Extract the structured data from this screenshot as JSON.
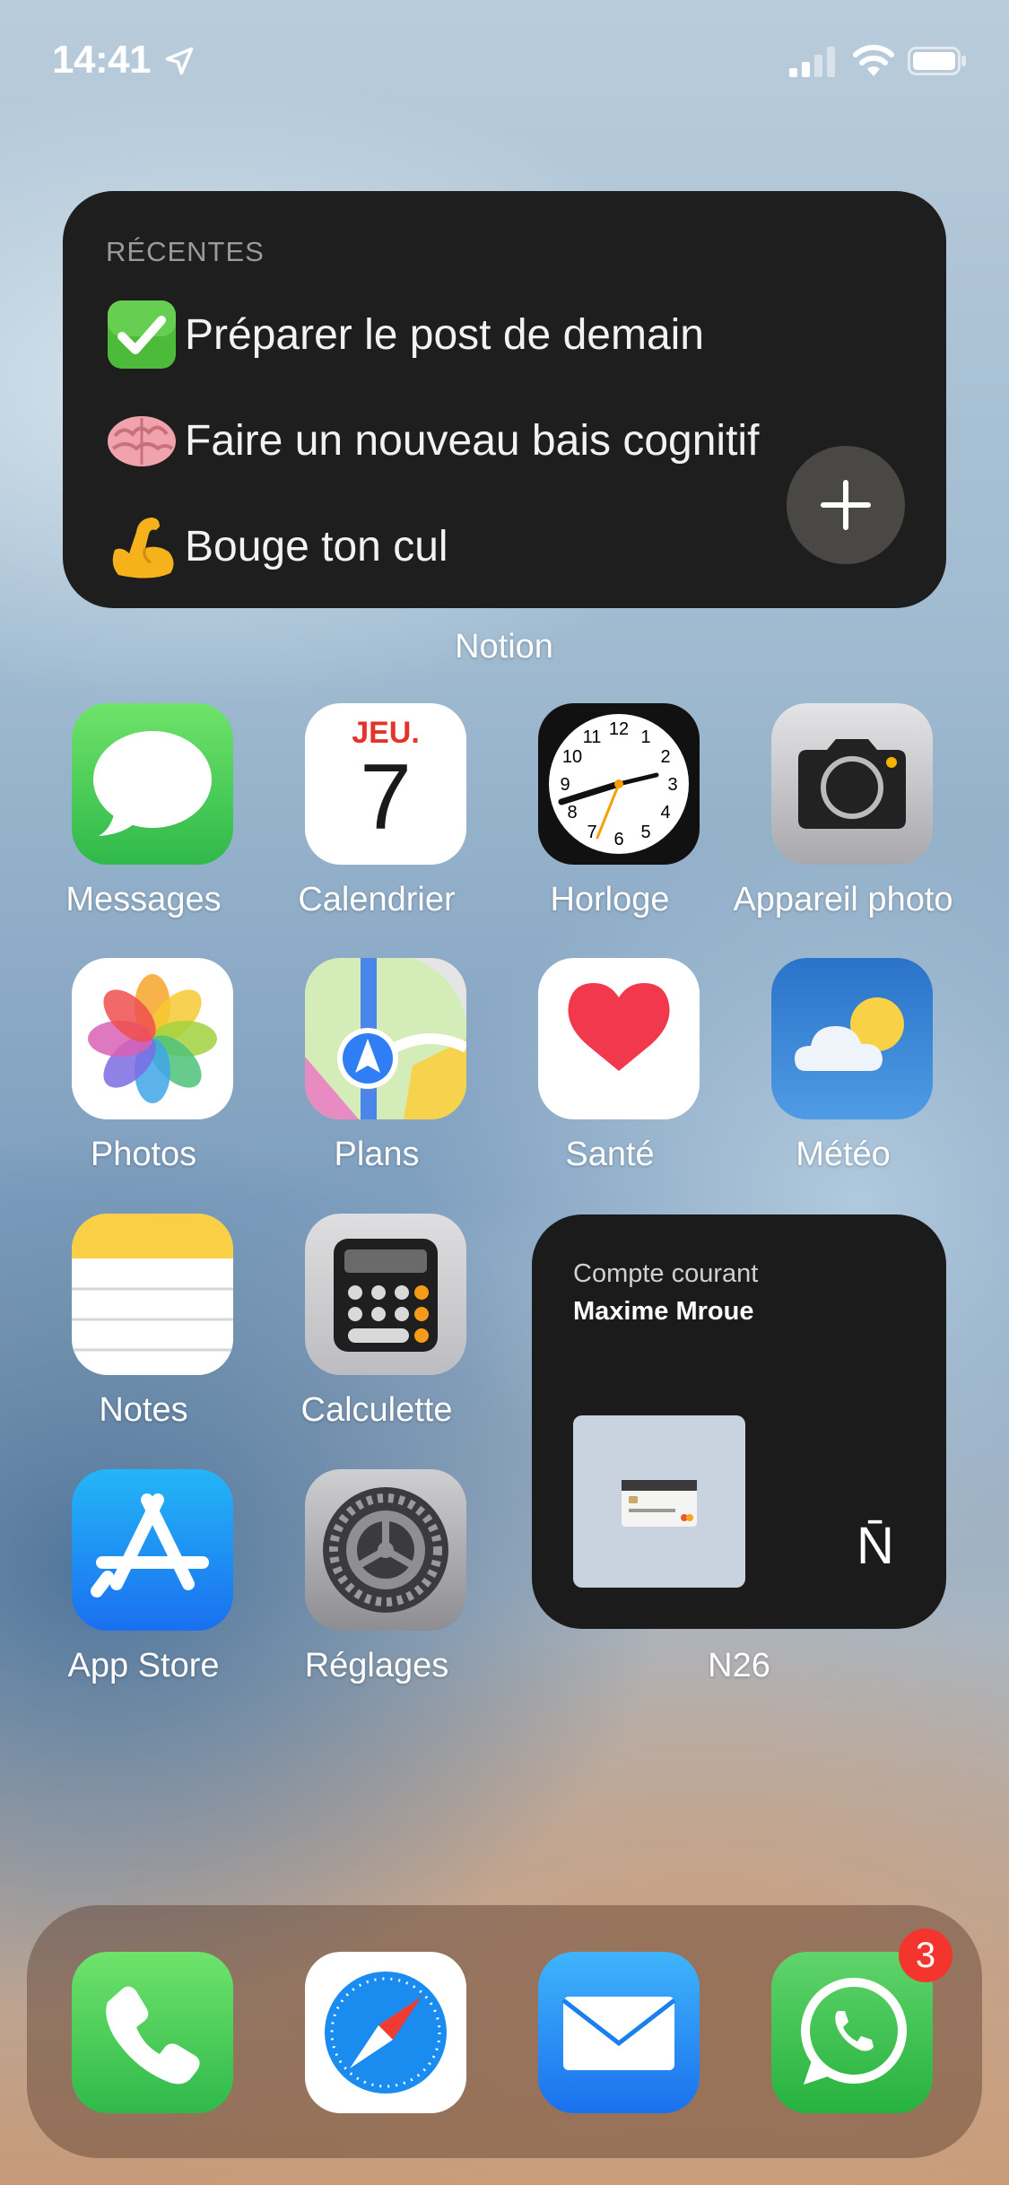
{
  "status_bar": {
    "time": "14:41",
    "icons": [
      "location-arrow-icon",
      "cellular-signal-icon",
      "wifi-icon",
      "battery-icon"
    ]
  },
  "notion_widget": {
    "header": "RÉCENTES",
    "items": [
      {
        "emoji": "✅",
        "text": "Préparer le post de demain"
      },
      {
        "emoji": "🧠",
        "text": "Faire un nouveau bais cognitif"
      },
      {
        "emoji": "💪",
        "text": "Bouge ton cul"
      }
    ],
    "add_icon": "plus-icon",
    "label": "Notion"
  },
  "apps": {
    "row1": [
      "Messages",
      "Calendrier",
      "Horloge",
      "Appareil photo"
    ],
    "row2": [
      "Photos",
      "Plans",
      "Santé",
      "Météo"
    ],
    "row3": [
      "Notes",
      "Calculette"
    ],
    "row4": [
      "App Store",
      "Réglages"
    ]
  },
  "calendar_icon": {
    "day": "JEU.",
    "date": "7"
  },
  "clock_icon": {
    "numbers": [
      "12",
      "1",
      "2",
      "3",
      "4",
      "5",
      "6",
      "7",
      "8",
      "9",
      "10",
      "11"
    ]
  },
  "n26_widget": {
    "account_type": "Compte courant",
    "owner": "Maxime Mroue",
    "logo": "N̄",
    "label": "N26"
  },
  "dock": {
    "apps": [
      "phone-icon",
      "safari-icon",
      "mail-icon",
      "whatsapp-icon"
    ],
    "whatsapp_badge": "3"
  },
  "colors": {
    "notion_bg": "#1e1e1e",
    "badge": "#f3352e",
    "messages_green": "#34c759",
    "calendar_red": "#e5322b"
  }
}
